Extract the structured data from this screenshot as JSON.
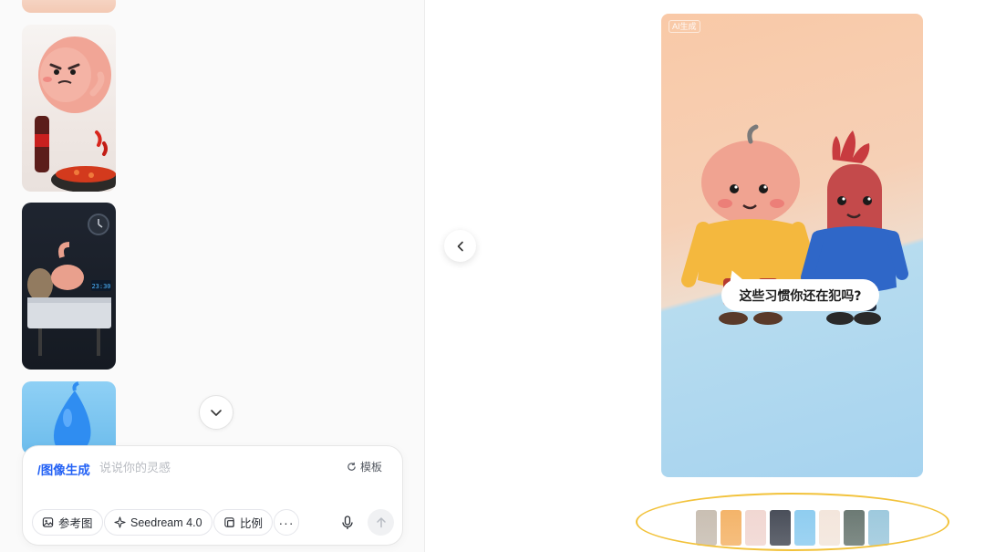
{
  "left_panel": {
    "thumbnails": [
      {
        "name": "pink-character-thumbnail"
      },
      {
        "name": "stomach-hotpot-thumbnail"
      },
      {
        "name": "stomach-night-desk-thumbnail",
        "clock_text": "23:30"
      },
      {
        "name": "blue-drop-thumbnail"
      }
    ]
  },
  "composer": {
    "command": "/图像生成",
    "placeholder": "说说你的灵感",
    "template_label": "模板",
    "chips": {
      "reference": "参考图",
      "model": "Seedream 4.0",
      "ratio": "比例",
      "more": "···"
    }
  },
  "preview": {
    "badge": "AI生成",
    "bubble_text": "这些习惯你还在犯吗?"
  },
  "strip": {
    "colors": [
      "#c9bfb3",
      "#f4b46a",
      "#f1d7d2",
      "#4a4f5a",
      "#8fcdf0",
      "#f3e6dc",
      "#6c7a74",
      "#9ec9dd"
    ]
  },
  "colors": {
    "accent": "#2462f5",
    "highlight": "#f2c23a"
  }
}
